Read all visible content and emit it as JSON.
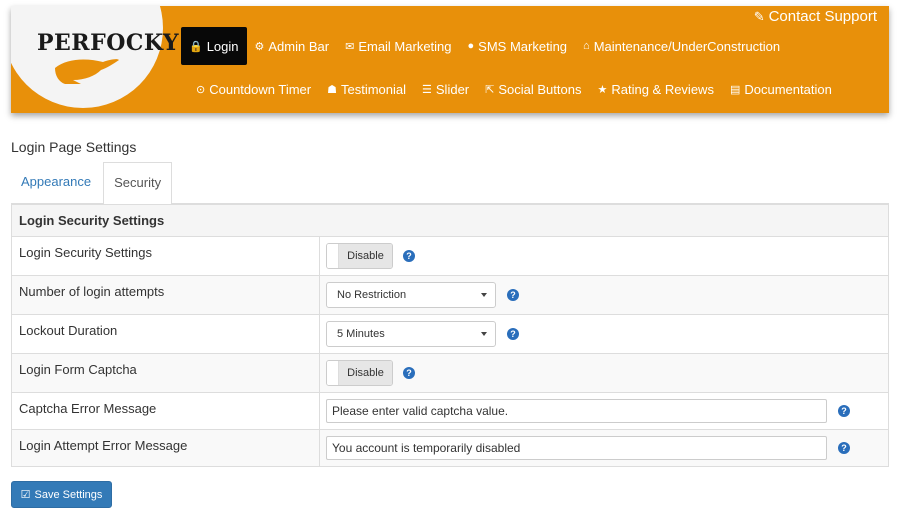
{
  "brand": {
    "logo_text": "PERFOCKY"
  },
  "header": {
    "contact_support": "Contact Support",
    "nav_row1": [
      {
        "label": "Login",
        "icon": "lock-icon",
        "glyph": "🔒",
        "active": true
      },
      {
        "label": "Admin Bar",
        "icon": "gear-icon",
        "glyph": "⚙"
      },
      {
        "label": "Email Marketing",
        "icon": "envelope-icon",
        "glyph": "✉"
      },
      {
        "label": "SMS Marketing",
        "icon": "comments-icon",
        "glyph": "💬"
      },
      {
        "label": "Maintenance/UnderConstruction",
        "icon": "home-icon",
        "glyph": "⌂"
      }
    ],
    "nav_row2": [
      {
        "label": "Countdown Timer",
        "icon": "clock-icon",
        "glyph": "⊙"
      },
      {
        "label": "Testimonial",
        "icon": "users-icon",
        "glyph": "👥"
      },
      {
        "label": "Slider",
        "icon": "sliders-icon",
        "glyph": "☰"
      },
      {
        "label": "Social Buttons",
        "icon": "share-icon",
        "glyph": "↗"
      },
      {
        "label": "Rating & Reviews",
        "icon": "star-icon",
        "glyph": "★"
      },
      {
        "label": "Documentation",
        "icon": "book-icon",
        "glyph": "▤"
      }
    ]
  },
  "page": {
    "title": "Login Page Settings",
    "tabs": [
      {
        "label": "Appearance",
        "active": false
      },
      {
        "label": "Security",
        "active": true
      }
    ]
  },
  "table": {
    "heading": "Login Security Settings",
    "rows": [
      {
        "label": "Login Security Settings",
        "type": "toggle",
        "value": "Disable"
      },
      {
        "label": "Number of login attempts",
        "type": "select",
        "value": "No Restriction"
      },
      {
        "label": "Lockout Duration",
        "type": "select",
        "value": "5 Minutes"
      },
      {
        "label": "Login Form Captcha",
        "type": "toggle",
        "value": "Disable"
      },
      {
        "label": "Captcha Error Message",
        "type": "text",
        "value": "Please enter valid captcha value."
      },
      {
        "label": "Login Attempt Error Message",
        "type": "text",
        "value": "You account is temporarily disabled"
      }
    ],
    "help_glyph": "?"
  },
  "actions": {
    "save_label": "Save Settings"
  },
  "colors": {
    "header_bg": "#e8900a",
    "active_nav_bg": "#080808",
    "primary": "#337ab7",
    "help_icon": "#2a6ebb"
  }
}
